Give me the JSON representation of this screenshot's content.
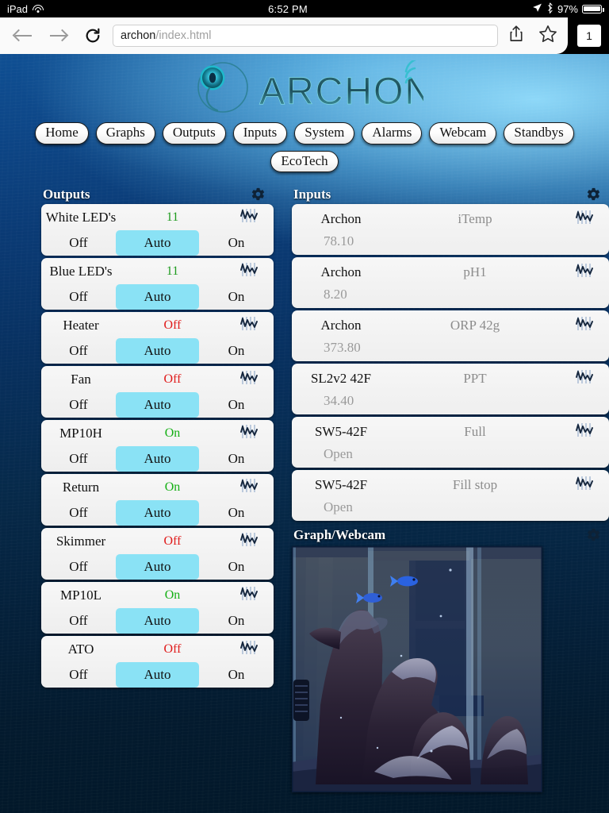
{
  "statusbar": {
    "device": "iPad",
    "wifi_icon": "wifi-icon",
    "time": "6:52 PM",
    "location_icon": "location-arrow-icon",
    "bluetooth_icon": "bluetooth-icon",
    "battery_percent": "97%",
    "battery_icon": "battery-icon"
  },
  "browser": {
    "back_icon": "back-arrow-icon",
    "forward_icon": "forward-arrow-icon",
    "reload_icon": "reload-icon",
    "url_host": "archon",
    "url_path": "/index.html",
    "share_icon": "share-icon",
    "bookmark_icon": "star-icon",
    "tab_count": "1"
  },
  "logo": {
    "wordmark": "ARCHON",
    "mark_icon": "archon-circle-icon",
    "signal_icon": "wifi-signal-icon"
  },
  "nav": {
    "row1": [
      {
        "label": "Home"
      },
      {
        "label": "Graphs"
      },
      {
        "label": "Outputs"
      },
      {
        "label": "Inputs"
      },
      {
        "label": "System"
      },
      {
        "label": "Alarms"
      },
      {
        "label": "Webcam"
      },
      {
        "label": "Standbys"
      }
    ],
    "row2": [
      {
        "label": "EcoTech"
      }
    ]
  },
  "outputs": {
    "title": "Outputs",
    "gear_icon": "gear-icon",
    "mode_labels": {
      "off": "Off",
      "auto": "Auto",
      "on": "On"
    },
    "items": [
      {
        "name": "White LED's",
        "state": "11",
        "state_kind": "num",
        "mode": "Auto",
        "graph_icon": "chart-icon"
      },
      {
        "name": "Blue LED's",
        "state": "11",
        "state_kind": "num",
        "mode": "Auto",
        "graph_icon": "chart-icon"
      },
      {
        "name": "Heater",
        "state": "Off",
        "state_kind": "off",
        "mode": "Auto",
        "graph_icon": "chart-icon"
      },
      {
        "name": "Fan",
        "state": "Off",
        "state_kind": "off",
        "mode": "Auto",
        "graph_icon": "chart-icon"
      },
      {
        "name": "MP10H",
        "state": "On",
        "state_kind": "on",
        "mode": "Auto",
        "graph_icon": "chart-icon"
      },
      {
        "name": "Return",
        "state": "On",
        "state_kind": "on",
        "mode": "Auto",
        "graph_icon": "chart-icon"
      },
      {
        "name": "Skimmer",
        "state": "Off",
        "state_kind": "off",
        "mode": "Auto",
        "graph_icon": "chart-icon"
      },
      {
        "name": "MP10L",
        "state": "On",
        "state_kind": "on",
        "mode": "Auto",
        "graph_icon": "chart-icon"
      },
      {
        "name": "ATO",
        "state": "Off",
        "state_kind": "off",
        "mode": "Auto",
        "graph_icon": "chart-icon"
      }
    ]
  },
  "inputs": {
    "title": "Inputs",
    "gear_icon": "gear-icon",
    "items": [
      {
        "device": "Archon",
        "type": "iTemp",
        "value": "78.10",
        "graph_icon": "chart-icon"
      },
      {
        "device": "Archon",
        "type": "pH1",
        "value": "8.20",
        "graph_icon": "chart-icon"
      },
      {
        "device": "Archon",
        "type": "ORP 42g",
        "value": "373.80",
        "graph_icon": "chart-icon"
      },
      {
        "device": "SL2v2 42F",
        "type": "PPT",
        "value": "34.40",
        "graph_icon": "chart-icon"
      },
      {
        "device": "SW5-42F",
        "type": "Full",
        "value": "Open",
        "graph_icon": "chart-icon"
      },
      {
        "device": "SW5-42F",
        "type": "Fill stop",
        "value": "Open",
        "graph_icon": "chart-icon"
      }
    ]
  },
  "webcam": {
    "title": "Graph/Webcam",
    "gear_icon": "gear-icon",
    "image_alt": "aquarium-webcam-live-view"
  },
  "colors": {
    "accent_cyan": "#8ae2f5",
    "state_on": "#16b016",
    "state_off": "#e01b1b",
    "state_number": "#1f9b1f",
    "panel_bg": "#f2f2f2",
    "water_deep": "#03203c",
    "water_light": "#96e1ff"
  }
}
